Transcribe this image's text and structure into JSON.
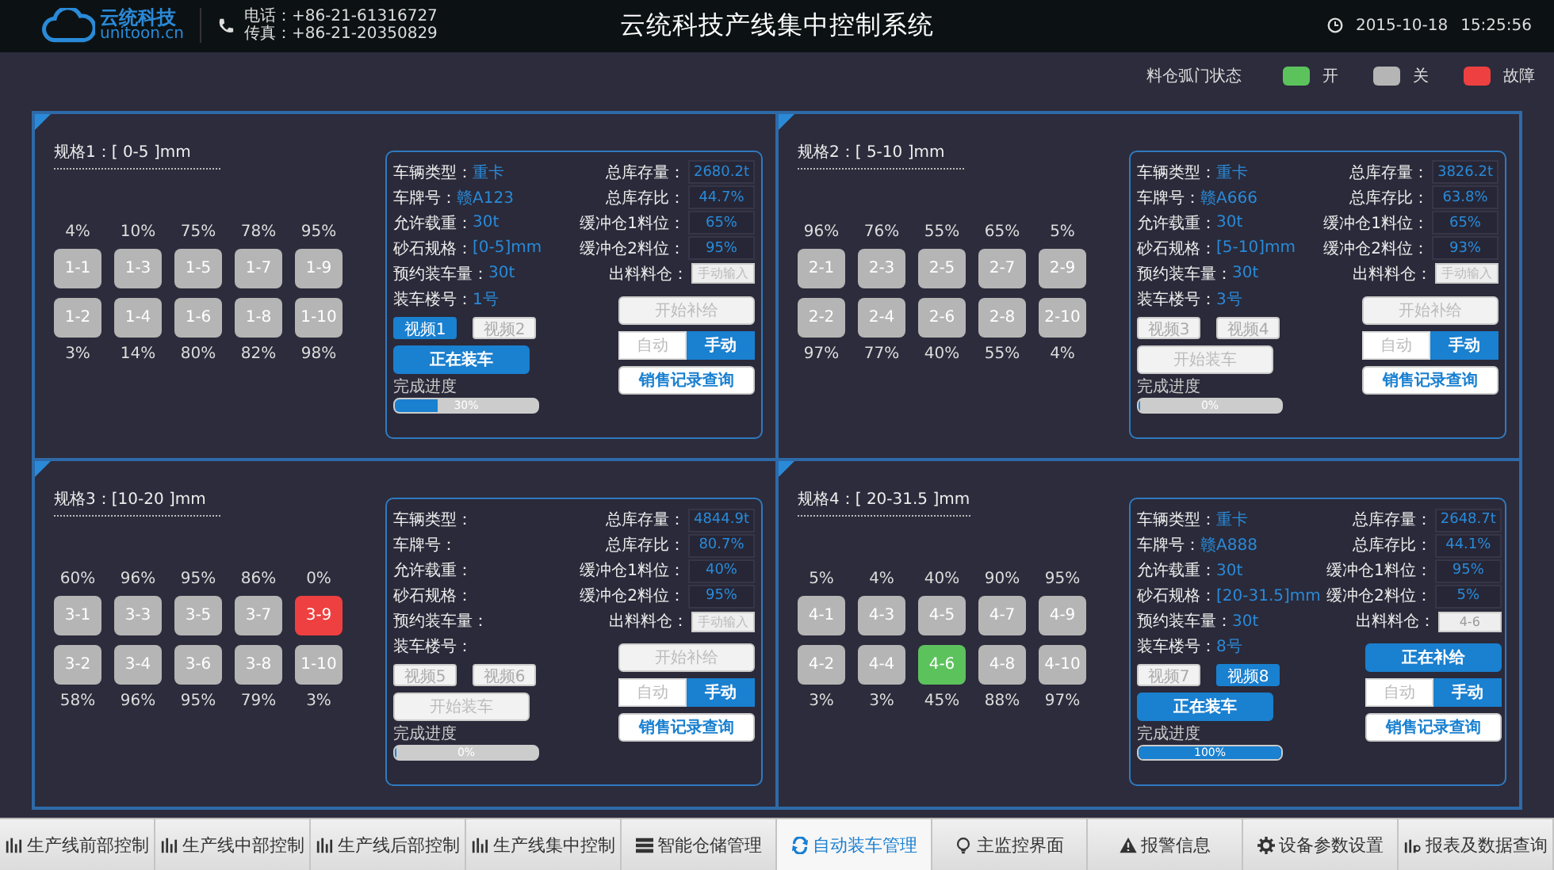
{
  "header": {
    "logo_name": "云统科技",
    "logo_domain": "unitoon.cn",
    "phone": "电话：+86-21-61316727",
    "fax": "传真：+86-21-20350829",
    "title": "云统科技产线集中控制系统",
    "date": "2015-10-18",
    "time": "15:25:56"
  },
  "legend": {
    "label": "料仓弧门状态",
    "items": [
      {
        "label": "开",
        "color": "#5cc25c"
      },
      {
        "label": "关",
        "color": "#b5b5b5"
      },
      {
        "label": "故障",
        "color": "#ee4040"
      }
    ]
  },
  "sections": [
    {
      "title": "规格1：[ 0-5 ]mm",
      "bins_top": [
        {
          "label": "1-1",
          "reading": "4%",
          "color": "#b5b5b5"
        },
        {
          "label": "1-3",
          "reading": "10%",
          "color": "#b5b5b5"
        },
        {
          "label": "1-5",
          "reading": "75%",
          "color": "#b5b5b5"
        },
        {
          "label": "1-7",
          "reading": "78%",
          "color": "#b5b5b5"
        },
        {
          "label": "1-9",
          "reading": "95%",
          "color": "#b5b5b5"
        }
      ],
      "bins_bottom": [
        {
          "label": "1-2",
          "reading": "3%",
          "color": "#b5b5b5"
        },
        {
          "label": "1-4",
          "reading": "14%",
          "color": "#b5b5b5"
        },
        {
          "label": "1-6",
          "reading": "80%",
          "color": "#b5b5b5"
        },
        {
          "label": "1-8",
          "reading": "82%",
          "color": "#b5b5b5"
        },
        {
          "label": "1-10",
          "reading": "98%",
          "color": "#b5b5b5"
        }
      ],
      "panel": {
        "info": [
          {
            "label": "车辆类型：",
            "value": "重卡"
          },
          {
            "label": "车牌号：",
            "value": "赣A123"
          },
          {
            "label": "允许载重：",
            "value": "30t"
          },
          {
            "label": "砂石规格：",
            "value": "[0-5]mm"
          },
          {
            "label": "预约装车量：",
            "value": "30t"
          },
          {
            "label": "装车楼号：",
            "value": "1号"
          }
        ],
        "stock": [
          {
            "label": "总库存量：",
            "value": "2680.2t"
          },
          {
            "label": "总库存比：",
            "value": "44.7%"
          },
          {
            "label": "缓冲仓1料位：",
            "value": "65%"
          },
          {
            "label": "缓冲仓2料位：",
            "value": "95%"
          }
        ],
        "outlet": {
          "label": "出料料仓：",
          "placeholder": "手动输入"
        },
        "videos": [
          {
            "label": "视频1",
            "selected": true
          },
          {
            "label": "视频2",
            "selected": false
          }
        ],
        "load_button": {
          "label": "正在装车",
          "active": true
        },
        "supply_button": {
          "label": "开始补给",
          "active": false
        },
        "modes": [
          {
            "label": "自动",
            "selected": false
          },
          {
            "label": "手动",
            "selected": true
          }
        ],
        "query_button": "销售记录查询",
        "progress": {
          "label": "完成进度",
          "level": 0.3,
          "reading": "30%"
        }
      }
    },
    {
      "title": "规格2：[ 5-10 ]mm",
      "bins_top": [
        {
          "label": "2-1",
          "reading": "96%",
          "color": "#b5b5b5"
        },
        {
          "label": "2-3",
          "reading": "76%",
          "color": "#b5b5b5"
        },
        {
          "label": "2-5",
          "reading": "55%",
          "color": "#b5b5b5"
        },
        {
          "label": "2-7",
          "reading": "65%",
          "color": "#b5b5b5"
        },
        {
          "label": "2-9",
          "reading": "5%",
          "color": "#b5b5b5"
        }
      ],
      "bins_bottom": [
        {
          "label": "2-2",
          "reading": "97%",
          "color": "#b5b5b5"
        },
        {
          "label": "2-4",
          "reading": "77%",
          "color": "#b5b5b5"
        },
        {
          "label": "2-6",
          "reading": "40%",
          "color": "#b5b5b5"
        },
        {
          "label": "2-8",
          "reading": "55%",
          "color": "#b5b5b5"
        },
        {
          "label": "2-10",
          "reading": "4%",
          "color": "#b5b5b5"
        }
      ],
      "panel": {
        "info": [
          {
            "label": "车辆类型：",
            "value": "重卡"
          },
          {
            "label": "车牌号：",
            "value": "赣A666"
          },
          {
            "label": "允许载重：",
            "value": "30t"
          },
          {
            "label": "砂石规格：",
            "value": "[5-10]mm"
          },
          {
            "label": "预约装车量：",
            "value": "30t"
          },
          {
            "label": "装车楼号：",
            "value": "3号"
          }
        ],
        "stock": [
          {
            "label": "总库存量：",
            "value": "3826.2t"
          },
          {
            "label": "总库存比：",
            "value": "63.8%"
          },
          {
            "label": "缓冲仓1料位：",
            "value": "65%"
          },
          {
            "label": "缓冲仓2料位：",
            "value": "93%"
          }
        ],
        "outlet": {
          "label": "出料料仓：",
          "placeholder": "手动输入"
        },
        "videos": [
          {
            "label": "视频3",
            "selected": false
          },
          {
            "label": "视频4",
            "selected": false
          }
        ],
        "load_button": {
          "label": "开始装车",
          "active": false
        },
        "supply_button": {
          "label": "开始补给",
          "active": false
        },
        "modes": [
          {
            "label": "自动",
            "selected": false
          },
          {
            "label": "手动",
            "selected": true
          }
        ],
        "query_button": "销售记录查询",
        "progress": {
          "label": "完成进度",
          "level": 0,
          "reading": "0%"
        }
      }
    },
    {
      "title": "规格3：[10-20 ]mm",
      "bins_top": [
        {
          "label": "3-1",
          "reading": "60%",
          "color": "#b5b5b5"
        },
        {
          "label": "3-3",
          "reading": "96%",
          "color": "#b5b5b5"
        },
        {
          "label": "3-5",
          "reading": "95%",
          "color": "#b5b5b5"
        },
        {
          "label": "3-7",
          "reading": "86%",
          "color": "#b5b5b5"
        },
        {
          "label": "3-9",
          "reading": "0%",
          "color": "#ee4040"
        }
      ],
      "bins_bottom": [
        {
          "label": "3-2",
          "reading": "58%",
          "color": "#b5b5b5"
        },
        {
          "label": "3-4",
          "reading": "96%",
          "color": "#b5b5b5"
        },
        {
          "label": "3-6",
          "reading": "95%",
          "color": "#b5b5b5"
        },
        {
          "label": "3-8",
          "reading": "79%",
          "color": "#b5b5b5"
        },
        {
          "label": "1-10",
          "reading": "3%",
          "color": "#b5b5b5"
        }
      ],
      "panel": {
        "info": [
          {
            "label": "车辆类型："
          },
          {
            "label": "车牌号："
          },
          {
            "label": "允许载重："
          },
          {
            "label": "砂石规格："
          },
          {
            "label": "预约装车量："
          },
          {
            "label": "装车楼号："
          }
        ],
        "stock": [
          {
            "label": "总库存量：",
            "value": "4844.9t"
          },
          {
            "label": "总库存比：",
            "value": "80.7%"
          },
          {
            "label": "缓冲仓1料位：",
            "value": "40%"
          },
          {
            "label": "缓冲仓2料位：",
            "value": "95%"
          }
        ],
        "outlet": {
          "label": "出料料仓：",
          "placeholder": "手动输入"
        },
        "videos": [
          {
            "label": "视频5",
            "selected": false
          },
          {
            "label": "视频6",
            "selected": false
          }
        ],
        "load_button": {
          "label": "开始装车",
          "active": false
        },
        "supply_button": {
          "label": "开始补给",
          "active": false
        },
        "modes": [
          {
            "label": "自动",
            "selected": false
          },
          {
            "label": "手动",
            "selected": true
          }
        ],
        "query_button": "销售记录查询",
        "progress": {
          "label": "完成进度",
          "level": 0,
          "reading": "0%"
        }
      }
    },
    {
      "title": "规格4：[ 20-31.5 ]mm",
      "bins_top": [
        {
          "label": "4-1",
          "reading": "5%",
          "color": "#b5b5b5"
        },
        {
          "label": "4-3",
          "reading": "4%",
          "color": "#b5b5b5"
        },
        {
          "label": "4-5",
          "reading": "40%",
          "color": "#b5b5b5"
        },
        {
          "label": "4-7",
          "reading": "90%",
          "color": "#b5b5b5"
        },
        {
          "label": "4-9",
          "reading": "95%",
          "color": "#b5b5b5"
        }
      ],
      "bins_bottom": [
        {
          "label": "4-2",
          "reading": "3%",
          "color": "#b5b5b5"
        },
        {
          "label": "4-4",
          "reading": "3%",
          "color": "#b5b5b5"
        },
        {
          "label": "4-6",
          "reading": "45%",
          "color": "#5cc25c"
        },
        {
          "label": "4-8",
          "reading": "88%",
          "color": "#b5b5b5"
        },
        {
          "label": "4-10",
          "reading": "97%",
          "color": "#b5b5b5"
        }
      ],
      "panel": {
        "info": [
          {
            "label": "车辆类型：",
            "value": "重卡"
          },
          {
            "label": "车牌号：",
            "value": "赣A888"
          },
          {
            "label": "允许载重：",
            "value": "30t"
          },
          {
            "label": "砂石规格：",
            "value": "[20-31.5]mm"
          },
          {
            "label": "预约装车量：",
            "value": "30t"
          },
          {
            "label": "装车楼号：",
            "value": "8号"
          }
        ],
        "stock": [
          {
            "label": "总库存量：",
            "value": "2648.7t"
          },
          {
            "label": "总库存比：",
            "value": "44.1%"
          },
          {
            "label": "缓冲仓1料位：",
            "value": "95%"
          },
          {
            "label": "缓冲仓2料位：",
            "value": "5%"
          }
        ],
        "outlet": {
          "label": "出料料仓：",
          "value": "4-6"
        },
        "videos": [
          {
            "label": "视频7",
            "selected": false
          },
          {
            "label": "视频8",
            "selected": true
          }
        ],
        "load_button": {
          "label": "正在装车",
          "active": true
        },
        "supply_button": {
          "label": "正在补给",
          "active": true
        },
        "modes": [
          {
            "label": "自动",
            "selected": false
          },
          {
            "label": "手动",
            "selected": true
          }
        ],
        "query_button": "销售记录查询",
        "progress": {
          "label": "完成进度",
          "level": 1,
          "reading": "100%"
        }
      }
    }
  ],
  "nav": [
    {
      "label": "生产线前部控制",
      "selected": false
    },
    {
      "label": "生产线中部控制",
      "selected": false
    },
    {
      "label": "生产线后部控制",
      "selected": false
    },
    {
      "label": "生产线集中控制",
      "selected": false
    },
    {
      "label": "智能仓储管理",
      "selected": false
    },
    {
      "label": "自动装车管理",
      "selected": true
    },
    {
      "label": "主监控界面",
      "selected": false
    },
    {
      "label": "报警信息",
      "selected": false
    },
    {
      "label": "设备参数设置",
      "selected": false
    },
    {
      "label": "报表及数据查询",
      "selected": false
    }
  ]
}
